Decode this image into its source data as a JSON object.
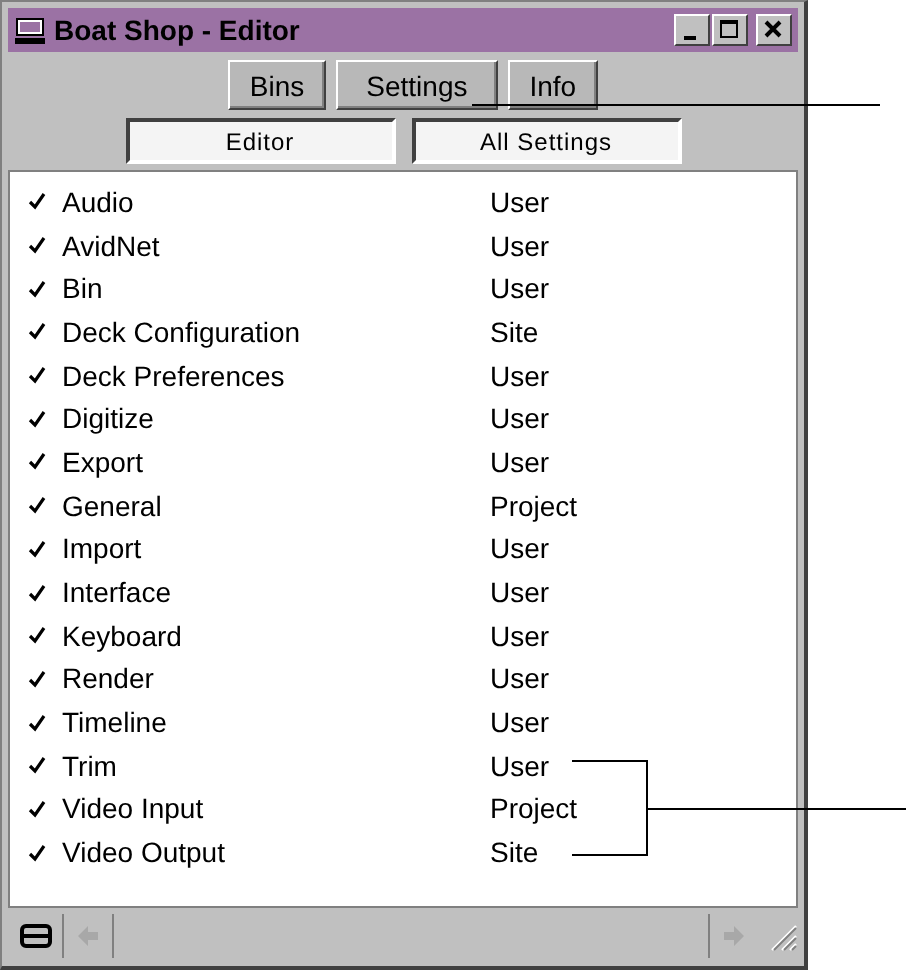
{
  "window": {
    "title": "Boat Shop - Editor"
  },
  "tabs": [
    {
      "label": "Bins"
    },
    {
      "label": "Settings"
    },
    {
      "label": "Info"
    }
  ],
  "scope_buttons": [
    "Editor",
    "All Settings"
  ],
  "settings": [
    {
      "name": "Audio",
      "scope": "User",
      "checked": true
    },
    {
      "name": "AvidNet",
      "scope": "User",
      "checked": true
    },
    {
      "name": "Bin",
      "scope": "User",
      "checked": true
    },
    {
      "name": "Deck Configuration",
      "scope": "Site",
      "checked": true
    },
    {
      "name": "Deck Preferences",
      "scope": "User",
      "checked": true
    },
    {
      "name": "Digitize",
      "scope": "User",
      "checked": true
    },
    {
      "name": "Export",
      "scope": "User",
      "checked": true
    },
    {
      "name": "General",
      "scope": "Project",
      "checked": true
    },
    {
      "name": "Import",
      "scope": "User",
      "checked": true
    },
    {
      "name": "Interface",
      "scope": "User",
      "checked": true
    },
    {
      "name": "Keyboard",
      "scope": "User",
      "checked": true
    },
    {
      "name": "Render",
      "scope": "User",
      "checked": true
    },
    {
      "name": "Timeline",
      "scope": "User",
      "checked": true
    },
    {
      "name": "Trim",
      "scope": "User",
      "checked": true
    },
    {
      "name": "Video Input",
      "scope": "Project",
      "checked": true
    },
    {
      "name": "Video Output",
      "scope": "Site",
      "checked": true
    }
  ]
}
